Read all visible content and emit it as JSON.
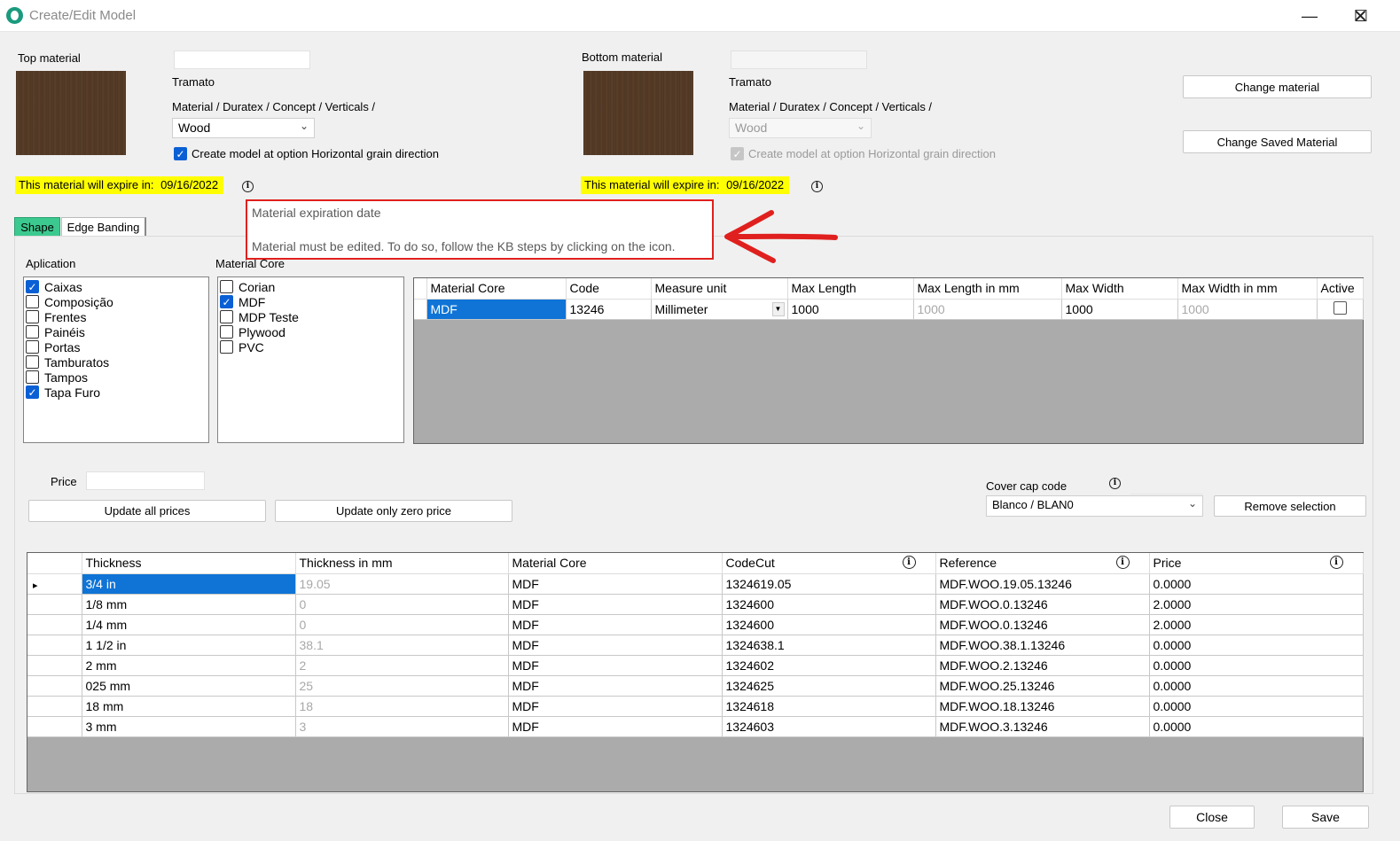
{
  "window": {
    "title": "Create/Edit Model"
  },
  "top": {
    "label": "Top material",
    "tramato": "Tramato",
    "path": "Material / Duratex / Concept / Verticals /",
    "combo": "Wood",
    "grain_label": "Create model at option Horizontal grain direction",
    "expire_prefix": "This material will expire in:",
    "expire_date": "09/16/2022"
  },
  "bottom": {
    "label": "Bottom material",
    "tramato": "Tramato",
    "path": "Material / Duratex / Concept / Verticals /",
    "combo": "Wood",
    "grain_label": "Create model at option Horizontal grain direction",
    "expire_prefix": "This material will expire in:",
    "expire_date": "09/16/2022"
  },
  "buttons": {
    "change_material": "Change material",
    "change_saved": "Change Saved Material",
    "update_all": "Update all prices",
    "update_zero": "Update only zero price",
    "remove_selection": "Remove selection",
    "close": "Close",
    "save": "Save"
  },
  "tooltip": {
    "title": "Material expiration date",
    "body": "Material must be edited. To do so, follow the KB steps by clicking on the icon."
  },
  "tabs": [
    "Shape",
    "Edge Banding"
  ],
  "aplication": {
    "label": "Aplication",
    "items": [
      {
        "label": "Caixas",
        "checked": true
      },
      {
        "label": "Composição",
        "checked": false
      },
      {
        "label": "Frentes",
        "checked": false
      },
      {
        "label": "Painéis",
        "checked": false
      },
      {
        "label": "Portas",
        "checked": false
      },
      {
        "label": "Tamburatos",
        "checked": false
      },
      {
        "label": "Tampos",
        "checked": false
      },
      {
        "label": "Tapa Furo",
        "checked": true
      }
    ]
  },
  "material_core": {
    "label": "Material Core",
    "items": [
      {
        "label": "Corian",
        "checked": false
      },
      {
        "label": "MDF",
        "checked": true
      },
      {
        "label": "MDP Teste",
        "checked": false
      },
      {
        "label": "Plywood",
        "checked": false
      },
      {
        "label": "PVC",
        "checked": false
      }
    ]
  },
  "core_grid": {
    "headers": [
      "Material Core",
      "Code",
      "Measure unit",
      "Max Length",
      "Max Length in mm",
      "Max Width",
      "Max Width in mm",
      "Active"
    ],
    "row": {
      "material_core": "MDF",
      "code": "13246",
      "measure_unit": "Millimeter",
      "max_length": "1000",
      "max_length_mm": "1000",
      "max_width": "1000",
      "max_width_mm": "1000",
      "active": false
    }
  },
  "price": {
    "label": "Price",
    "value": ""
  },
  "cover_cap": {
    "label": "Cover cap code",
    "value": "Blanco / BLAN0"
  },
  "thickness_grid": {
    "headers": [
      "Thickness",
      "Thickness in mm",
      "Material Core",
      "CodeCut",
      "Reference",
      "Price"
    ],
    "rows": [
      [
        "3/4 in",
        "19.05",
        "MDF",
        "1324619.05",
        "MDF.WOO.19.05.13246",
        "0.0000"
      ],
      [
        "1/8 mm",
        "0",
        "MDF",
        "1324600",
        "MDF.WOO.0.13246",
        "2.0000"
      ],
      [
        "1/4 mm",
        "0",
        "MDF",
        "1324600",
        "MDF.WOO.0.13246",
        "2.0000"
      ],
      [
        "1 1/2 in",
        "38.1",
        "MDF",
        "1324638.1",
        "MDF.WOO.38.1.13246",
        "0.0000"
      ],
      [
        "2 mm",
        "2",
        "MDF",
        "1324602",
        "MDF.WOO.2.13246",
        "0.0000"
      ],
      [
        "025 mm",
        "25",
        "MDF",
        "1324625",
        "MDF.WOO.25.13246",
        "0.0000"
      ],
      [
        "18 mm",
        "18",
        "MDF",
        "1324618",
        "MDF.WOO.18.13246",
        "0.0000"
      ],
      [
        "3 mm",
        "3",
        "MDF",
        "1324603",
        "MDF.WOO.3.13246",
        "0.0000"
      ]
    ]
  },
  "colors": {
    "accent": "#0f74d6",
    "highlight": "#ffff00",
    "tab_active": "#3cc98f",
    "annotation": "#e0201e"
  }
}
